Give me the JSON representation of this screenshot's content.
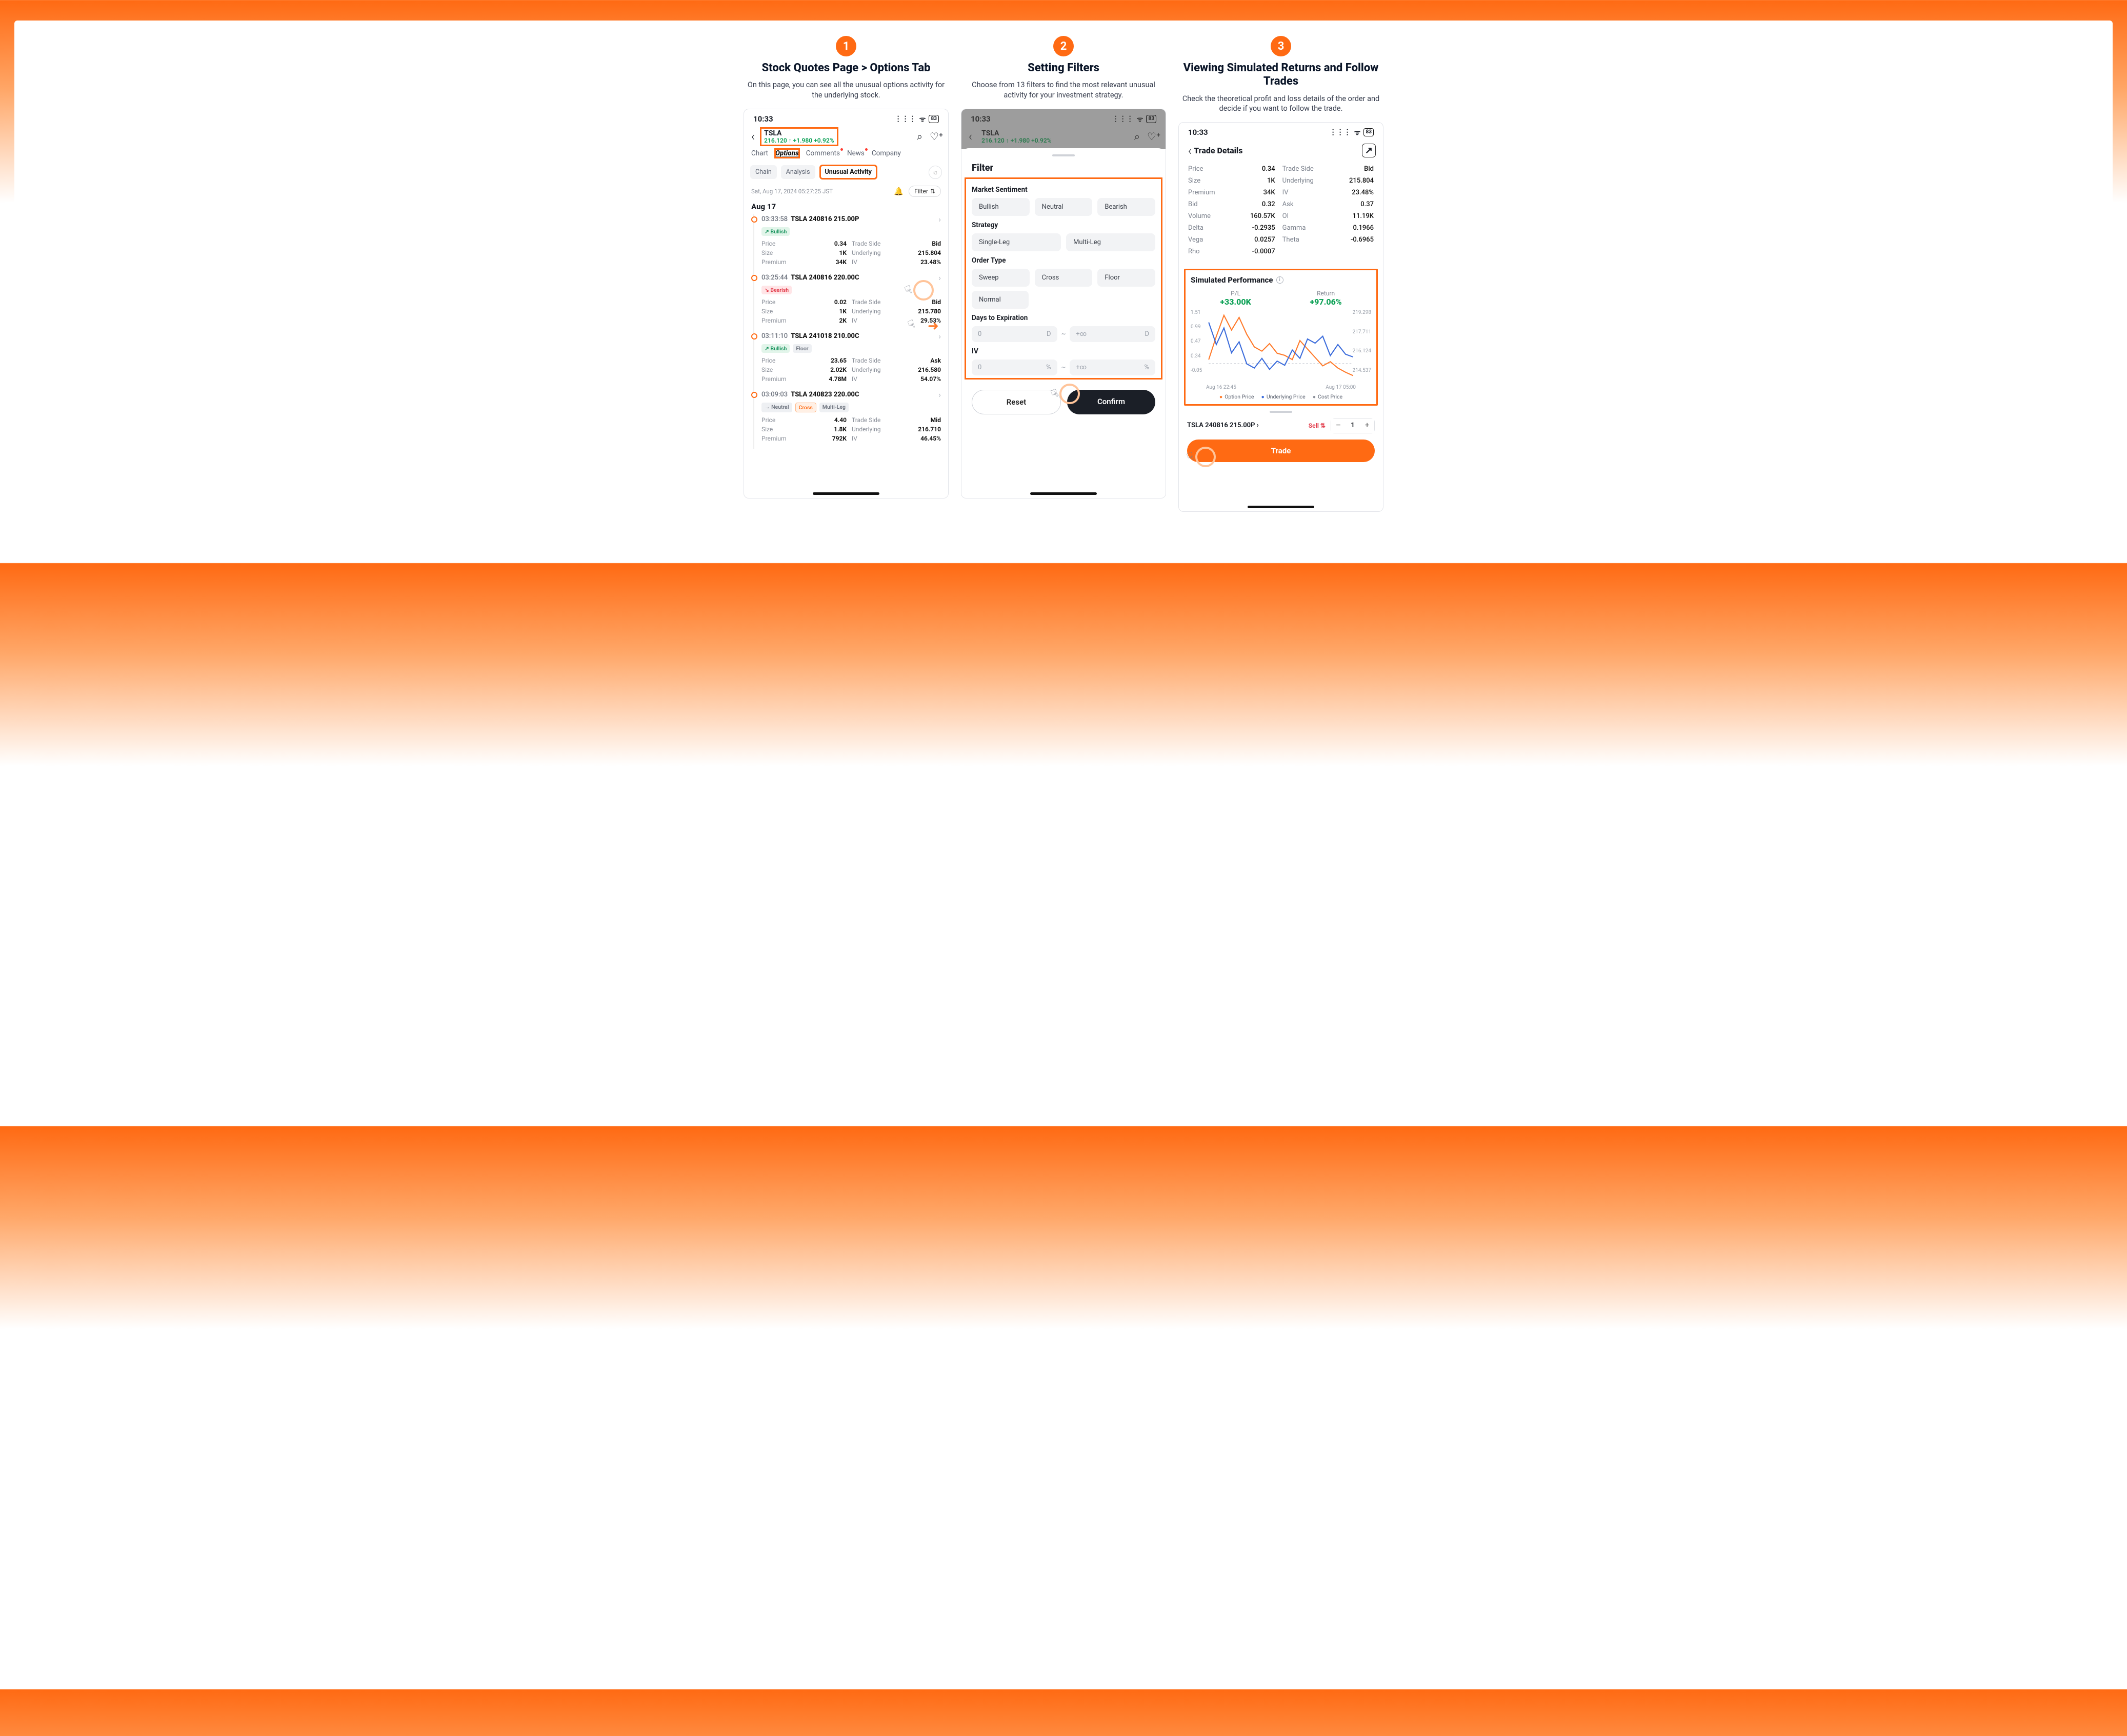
{
  "steps": [
    {
      "num": "1",
      "title": "Stock Quotes Page > Options Tab",
      "desc": "On this page, you can see all the unusual options activity for the underlying stock."
    },
    {
      "num": "2",
      "title": "Setting Filters",
      "desc": "Choose from 13 filters to find the most relevant unusual activity for your investment strategy."
    },
    {
      "num": "3",
      "title": "Viewing Simulated Returns and Follow Trades",
      "desc": "Check the theoretical profit and loss details of the order and decide if you want to follow the trade."
    }
  ],
  "status": {
    "time": "10:33",
    "battery": "83"
  },
  "ticker": {
    "symbol": "TSLA",
    "price": "216.120",
    "change": "+1.980",
    "pct": "+0.92%"
  },
  "tabs": {
    "chart": "Chart",
    "options": "Options",
    "comments": "Comments",
    "news": "News",
    "company": "Company"
  },
  "subtabs": {
    "chain": "Chain",
    "analysis": "Analysis",
    "unusual": "Unusual Activity"
  },
  "meta": {
    "timestamp": "Sat, Aug 17, 2024 05:27:25 JST",
    "filter": "Filter",
    "dateHead": "Aug 17"
  },
  "activities": [
    {
      "time": "03:33:58",
      "name": "TSLA 240816 215.00P",
      "chips": [
        {
          "text": "↗ Bullish",
          "cls": "bull"
        }
      ],
      "kv": {
        "Price": "0.34",
        "Trade Side": "Bid",
        "Size": "1K",
        "Underlying": "215.804",
        "Premium": "34K",
        "IV": "23.48%"
      }
    },
    {
      "time": "03:25:44",
      "name": "TSLA 240816 220.00C",
      "chips": [
        {
          "text": "↘ Bearish",
          "cls": "bear"
        }
      ],
      "kv": {
        "Price": "0.02",
        "Trade Side": "Bid",
        "Size": "1K",
        "Underlying": "215.780",
        "Premium": "2K",
        "IV": "29.53%"
      }
    },
    {
      "time": "03:11:10",
      "name": "TSLA 241018 210.00C",
      "chips": [
        {
          "text": "↗ Bullish",
          "cls": "bull"
        },
        {
          "text": "Floor",
          "cls": "floor"
        }
      ],
      "kv": {
        "Price": "23.65",
        "Trade Side": "Ask",
        "Size": "2.02K",
        "Underlying": "216.580",
        "Premium": "4.78M",
        "IV": "54.07%"
      }
    },
    {
      "time": "03:09:03",
      "name": "TSLA 240823 220.00C",
      "chips": [
        {
          "text": "→ Neutral",
          "cls": "neutral"
        },
        {
          "text": "Cross",
          "cls": "cross"
        },
        {
          "text": "Multi-Leg",
          "cls": "multi"
        }
      ],
      "kv": {
        "Price": "4.40",
        "Trade Side": "Mid",
        "Size": "1.8K",
        "Underlying": "216.710",
        "Premium": "792K",
        "IV": "46.45%"
      }
    }
  ],
  "filter": {
    "title": "Filter",
    "sentiment": {
      "label": "Market Sentiment",
      "opts": [
        "Bullish",
        "Neutral",
        "Bearish"
      ]
    },
    "strategy": {
      "label": "Strategy",
      "opts": [
        "Single-Leg",
        "Multi-Leg"
      ]
    },
    "orderType": {
      "label": "Order Type",
      "opts": [
        "Sweep",
        "Cross",
        "Floor",
        "Normal"
      ]
    },
    "dte": {
      "label": "Days to Expiration",
      "minPh": "0",
      "minUnit": "D",
      "sep": "~",
      "maxPh": "+∞",
      "maxUnit": "D"
    },
    "iv": {
      "label": "IV",
      "minPh": "0",
      "minUnit": "%",
      "sep": "~",
      "maxPh": "+∞",
      "maxUnit": "%"
    },
    "reset": "Reset",
    "confirm": "Confirm"
  },
  "details": {
    "title": "Trade Details",
    "rows": {
      "Price": "0.34",
      "Trade Side": "Bid",
      "Size": "1K",
      "Underlying": "215.804",
      "Premium": "34K",
      "IV": "23.48%",
      "Bid": "0.32",
      "Ask": "0.37",
      "Volume": "160.57K",
      "OI": "11.19K",
      "Delta": "-0.2935",
      "Gamma": "0.1966",
      "Vega": "0.0257",
      "Theta": "-0.6965",
      "Rho": "-0.0007"
    },
    "sim": {
      "title": "Simulated Performance",
      "plLabel": "P/L",
      "plValue": "+33.00K",
      "retLabel": "Return",
      "retValue": "+97.06%",
      "yl": [
        "1.51",
        "0.99",
        "0.47",
        "0.34",
        "-0.05"
      ],
      "yr": [
        "219.298",
        "217.711",
        "216.124",
        "214.537"
      ],
      "xl": [
        "Aug 16 22:45",
        "Aug 17 05:00"
      ],
      "legend": {
        "opt": "Option Price",
        "und": "Underlying Price",
        "cost": "Cost Price"
      }
    },
    "tradeRow": {
      "name": "TSLA 240816 215.00P",
      "side": "Sell",
      "qty": "1",
      "btn": "Trade"
    }
  },
  "chart_data": {
    "type": "line",
    "title": "Simulated Performance",
    "x_range_labels": [
      "Aug 16 22:45",
      "Aug 17 05:00"
    ],
    "left_axis": {
      "label": "Option Price",
      "range": [
        -0.05,
        1.51
      ],
      "ticks": [
        1.51,
        0.99,
        0.47,
        0.34,
        -0.05
      ]
    },
    "right_axis": {
      "label": "Underlying Price",
      "range": [
        214.537,
        219.298
      ],
      "ticks": [
        219.298,
        217.711,
        216.124,
        214.537
      ]
    },
    "cost_line": 0.34,
    "series": [
      {
        "name": "Option Price",
        "axis": "left",
        "color": "#ff7a2a",
        "values": [
          0.4,
          0.95,
          1.45,
          1.1,
          1.4,
          1.0,
          0.7,
          0.6,
          0.78,
          0.55,
          0.5,
          0.4,
          0.85,
          0.65,
          0.45,
          0.25,
          0.35,
          0.2,
          0.1,
          0.02
        ]
      },
      {
        "name": "Underlying Price",
        "axis": "right",
        "color": "#3a6bdb",
        "values": [
          218.6,
          217.0,
          218.2,
          216.4,
          217.2,
          215.6,
          215.3,
          216.0,
          215.2,
          215.8,
          215.5,
          216.6,
          216.0,
          217.4,
          217.1,
          217.6,
          216.2,
          217.0,
          216.3,
          216.1
        ]
      }
    ],
    "metrics": {
      "P/L": "+33.00K",
      "Return": "+97.06%"
    }
  }
}
